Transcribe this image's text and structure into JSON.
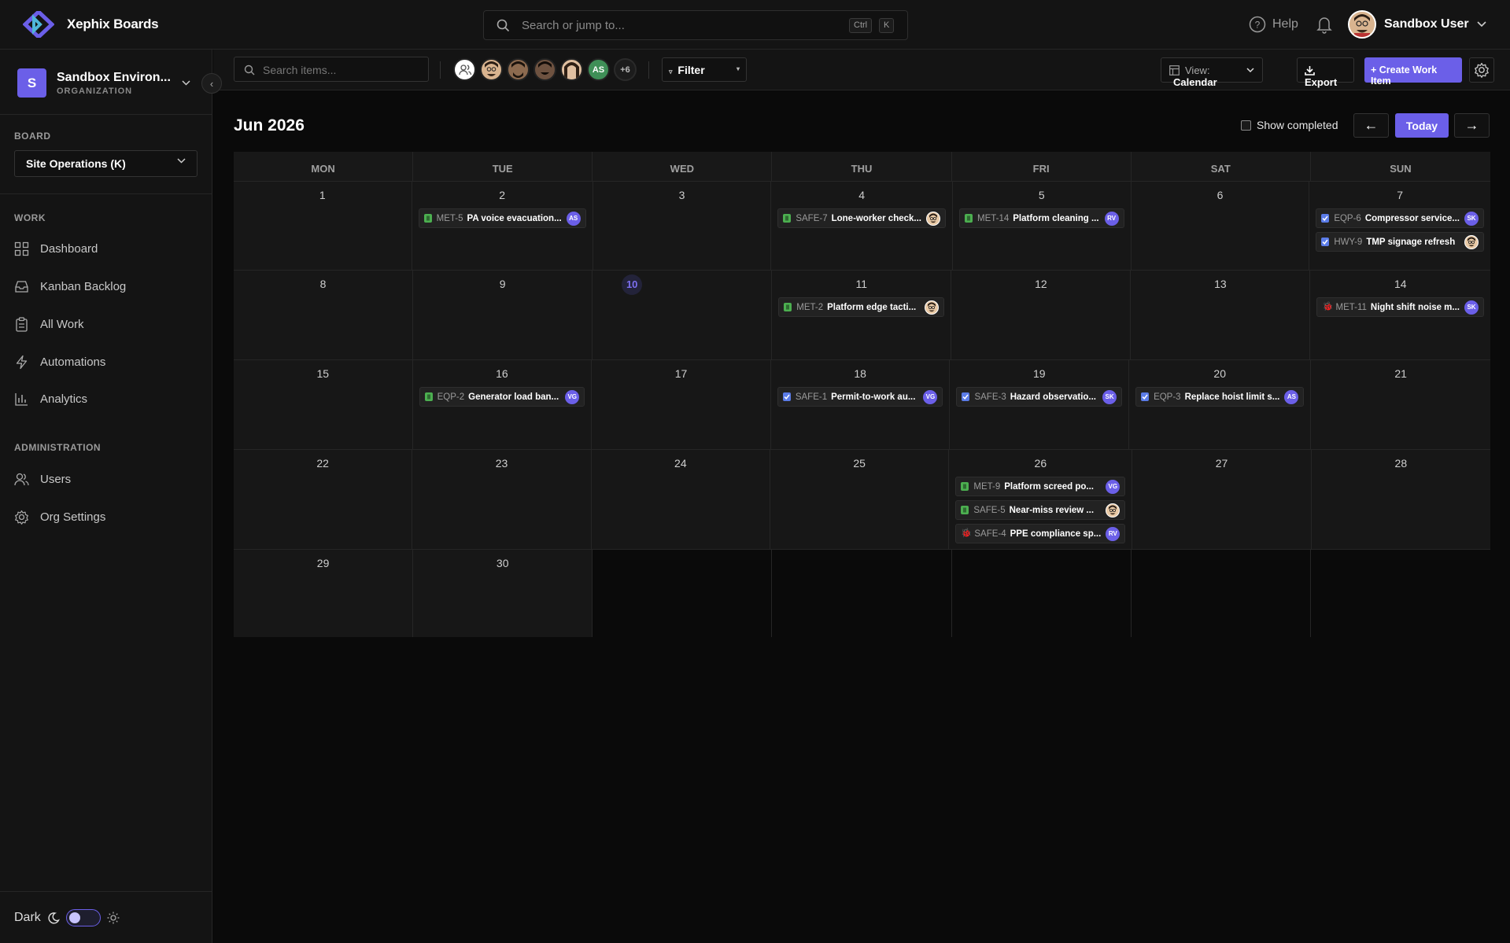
{
  "app": {
    "title": "Xephix Boards"
  },
  "global_search": {
    "placeholder": "Search or jump to...",
    "kbd1": "Ctrl",
    "kbd2": "K"
  },
  "header": {
    "help": "Help",
    "user_name": "Sandbox User"
  },
  "org": {
    "initial": "S",
    "name": "Sandbox Environ...",
    "type": "ORGANIZATION"
  },
  "board": {
    "label": "BOARD",
    "selected": "Site Operations (K)"
  },
  "work_section": {
    "label": "WORK",
    "items": [
      "Dashboard",
      "Kanban Backlog",
      "All Work",
      "Automations",
      "Analytics"
    ]
  },
  "admin_section": {
    "label": "ADMINISTRATION",
    "items": [
      "Users",
      "Org Settings"
    ]
  },
  "theme": {
    "label": "Dark"
  },
  "toolbar": {
    "search_placeholder": "Search items...",
    "avatar_initials": "AS",
    "more_count": "+6",
    "filter": "Filter",
    "view_label": "View:",
    "view_value": "Calendar",
    "export": "Export",
    "create": "+ Create Work Item"
  },
  "calendar": {
    "month": "Jun 2026",
    "show_completed": "Show completed",
    "prev": "←",
    "today": "Today",
    "next": "→",
    "weekdays": [
      "MON",
      "TUE",
      "WED",
      "THU",
      "FRI",
      "SAT",
      "SUN"
    ],
    "today_date": "10",
    "weeks": [
      [
        {
          "day": "1",
          "events": []
        },
        {
          "day": "2",
          "events": [
            {
              "type": "story",
              "key": "MET-5",
              "title": "PA voice evacuation...",
              "who": "AS"
            }
          ]
        },
        {
          "day": "3",
          "events": []
        },
        {
          "day": "4",
          "events": [
            {
              "type": "story",
              "key": "SAFE-7",
              "title": "Lone-worker check...",
              "who": "face"
            }
          ]
        },
        {
          "day": "5",
          "events": [
            {
              "type": "story",
              "key": "MET-14",
              "title": "Platform cleaning ...",
              "who": "RV"
            }
          ]
        },
        {
          "day": "6",
          "events": []
        },
        {
          "day": "7",
          "events": [
            {
              "type": "task",
              "key": "EQP-6",
              "title": "Compressor service...",
              "who": "SK"
            },
            {
              "type": "task",
              "key": "HWY-9",
              "title": "TMP signage refresh",
              "who": "face"
            }
          ]
        }
      ],
      [
        {
          "day": "8",
          "events": []
        },
        {
          "day": "9",
          "events": []
        },
        {
          "day": "10",
          "events": [],
          "today": true
        },
        {
          "day": "11",
          "events": [
            {
              "type": "story",
              "key": "MET-2",
              "title": "Platform edge tacti...",
              "who": "face"
            }
          ]
        },
        {
          "day": "12",
          "events": []
        },
        {
          "day": "13",
          "events": []
        },
        {
          "day": "14",
          "events": [
            {
              "type": "bug",
              "key": "MET-11",
              "title": "Night shift noise m...",
              "who": "SK"
            }
          ]
        }
      ],
      [
        {
          "day": "15",
          "events": []
        },
        {
          "day": "16",
          "events": [
            {
              "type": "story",
              "key": "EQP-2",
              "title": "Generator load ban...",
              "who": "VG"
            }
          ]
        },
        {
          "day": "17",
          "events": []
        },
        {
          "day": "18",
          "events": [
            {
              "type": "task",
              "key": "SAFE-1",
              "title": "Permit-to-work au...",
              "who": "VG"
            }
          ]
        },
        {
          "day": "19",
          "events": [
            {
              "type": "task",
              "key": "SAFE-3",
              "title": "Hazard observatio...",
              "who": "SK"
            }
          ]
        },
        {
          "day": "20",
          "events": [
            {
              "type": "task",
              "key": "EQP-3",
              "title": "Replace hoist limit s...",
              "who": "AS"
            }
          ]
        },
        {
          "day": "21",
          "events": []
        }
      ],
      [
        {
          "day": "22",
          "events": []
        },
        {
          "day": "23",
          "events": []
        },
        {
          "day": "24",
          "events": []
        },
        {
          "day": "25",
          "events": []
        },
        {
          "day": "26",
          "events": [
            {
              "type": "story",
              "key": "MET-9",
              "title": "Platform screed po...",
              "who": "VG"
            },
            {
              "type": "story",
              "key": "SAFE-5",
              "title": "Near-miss review ...",
              "who": "face"
            },
            {
              "type": "bug",
              "key": "SAFE-4",
              "title": "PPE compliance sp...",
              "who": "RV"
            }
          ]
        },
        {
          "day": "27",
          "events": []
        },
        {
          "day": "28",
          "events": []
        }
      ],
      [
        {
          "day": "29",
          "events": []
        },
        {
          "day": "30",
          "events": []
        },
        {
          "day": "",
          "events": [],
          "empty": true
        },
        {
          "day": "",
          "events": [],
          "empty": true
        },
        {
          "day": "",
          "events": [],
          "empty": true
        },
        {
          "day": "",
          "events": [],
          "empty": true
        },
        {
          "day": "",
          "events": [],
          "empty": true
        }
      ]
    ]
  },
  "colors": {
    "accent": "#6b5fe8",
    "story": "#4caf50",
    "task": "#5b7ce8",
    "bug": "#e05252"
  }
}
